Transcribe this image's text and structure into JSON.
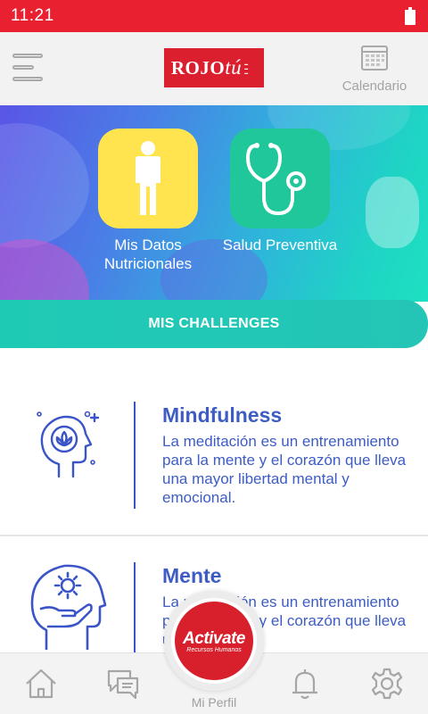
{
  "status_bar": {
    "time": "11:21"
  },
  "header": {
    "logo": "ROJOtú",
    "calendar_label": "Calendario"
  },
  "hero": {
    "tiles": [
      {
        "label": "Mis Datos Nutricionales",
        "icon": "person-icon",
        "color": "#ffe44f"
      },
      {
        "label": "Salud Preventiva",
        "icon": "stethoscope-icon",
        "color": "#1fc79a"
      }
    ]
  },
  "challenges_button": {
    "label": "MIS CHALLENGES"
  },
  "cards": [
    {
      "title": "Mindfulness",
      "description": "La meditación es un entrenamiento para la mente y el corazón que lleva una mayor libertad mental y emocional.",
      "icon": "head-lotus-icon"
    },
    {
      "title": "Mente",
      "description": "La meditación es un entrenamiento para la mente y el corazón que lleva una mayor",
      "icon": "head-hand-sun-icon"
    }
  ],
  "bottom_nav": {
    "items": [
      {
        "icon": "home-icon"
      },
      {
        "icon": "chat-icon"
      },
      {
        "icon": "bell-icon"
      },
      {
        "icon": "gear-icon"
      }
    ],
    "profile_label": "Mi Perfil",
    "profile_logo": "Activate",
    "profile_logo_sub": "Recursos Humanos"
  },
  "colors": {
    "status_red": "#e8202f",
    "brand_blue": "#3d5cc4",
    "teal": "#1fcab5"
  }
}
